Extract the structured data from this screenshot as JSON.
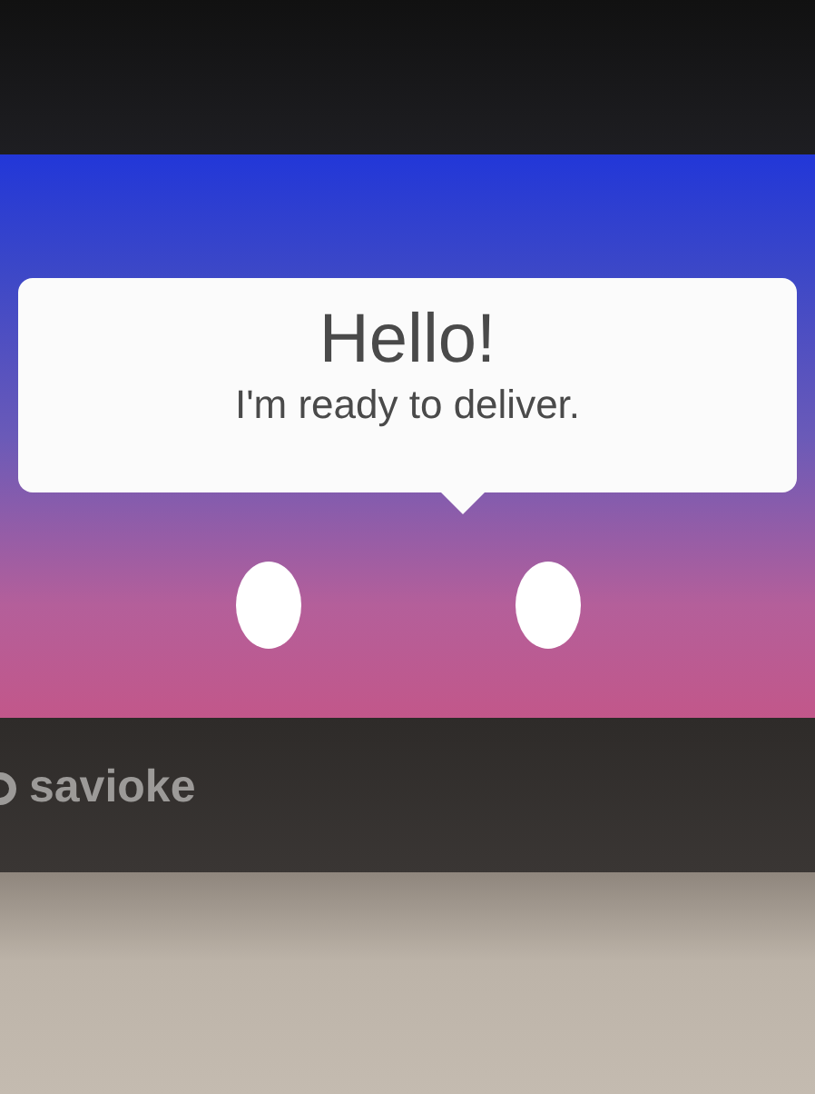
{
  "bubble": {
    "title": "Hello!",
    "message": "I'm ready to deliver."
  },
  "brand": {
    "name": "savioke"
  }
}
